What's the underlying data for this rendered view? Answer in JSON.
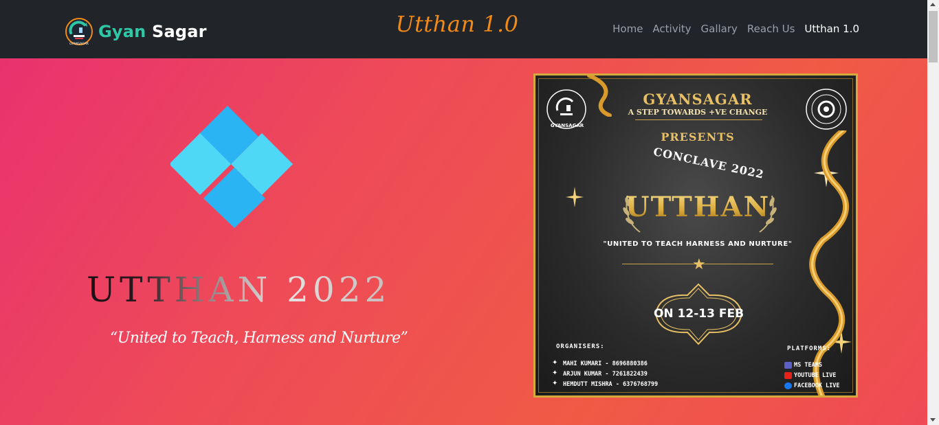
{
  "brand": {
    "part1": "Gyan",
    "part2": "Sagar",
    "logo_icon": "gyansagar-logo-icon",
    "logo_text": "GYANSAGAR"
  },
  "page_title": "Utthan 1.0",
  "nav": {
    "items": [
      {
        "label": "Home",
        "active": false
      },
      {
        "label": "Activity",
        "active": false
      },
      {
        "label": "Gallary",
        "active": false
      },
      {
        "label": "Reach Us",
        "active": false
      },
      {
        "label": "Utthan 1.0",
        "active": true
      }
    ]
  },
  "hero": {
    "logo_icon": "diamond-grid-logo-icon",
    "title": "UTTHAN 2022",
    "tagline": "“United to Teach, Harness and Nurture”"
  },
  "poster": {
    "title": "GYANSAGAR",
    "subtitle": "A STEP TOWARDS +VE CHANGE",
    "presents": "PRESENTS",
    "conclave": "CONCLAVE 2022",
    "event": "UTTHAN",
    "motto": "\"UNITED TO TEACH HARNESS AND NURTURE\"",
    "date": "ON 12-13 FEB",
    "organisers_heading": "ORGANISERS:",
    "organisers": [
      "MAHI KUMARI - 8696880386",
      "ARJUN KUMAR - 7261822439",
      "HEMDUTT MISHRA - 6376768799"
    ],
    "platforms_heading": "PLATFORMS:",
    "platforms": [
      {
        "label": "MS TEAMS",
        "icon": "ms-teams-icon",
        "color": "#5b5fc7"
      },
      {
        "label": "YOUTUBE LIVE",
        "icon": "youtube-icon",
        "color": "#e62117"
      },
      {
        "label": "FACEBOOK LIVE",
        "icon": "facebook-icon",
        "color": "#1877f2"
      }
    ]
  },
  "colors": {
    "navbar_bg": "#212529",
    "brand_accent": "#2ec8a6",
    "title_accent": "#f28a17",
    "hero_gradient_start": "#e8326f",
    "hero_gradient_end": "#f05a45",
    "diamond_blue": "#29b6f6",
    "poster_gold": "#e7c065"
  }
}
